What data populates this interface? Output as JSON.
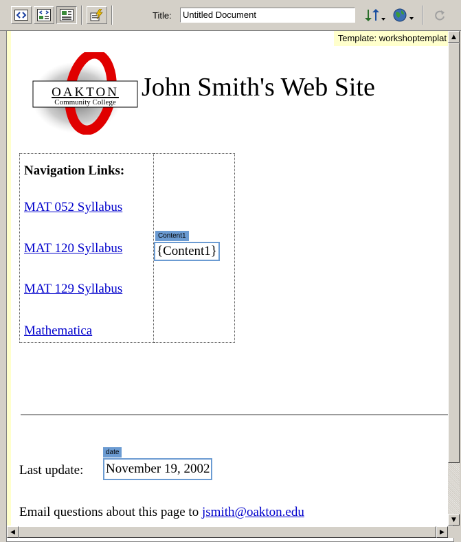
{
  "toolbar": {
    "title_label": "Title:",
    "title_value": "Untitled Document",
    "buttons": [
      {
        "name": "code-view-icon",
        "glyph": "<>"
      },
      {
        "name": "split-view-icon"
      },
      {
        "name": "design-view-icon"
      },
      {
        "name": "live-data-icon"
      },
      {
        "name": "file-management-icon"
      },
      {
        "name": "preview-browser-icon"
      },
      {
        "name": "refresh-icon"
      }
    ]
  },
  "document": {
    "template_tag": "Template: workshoptemplat",
    "logo": {
      "name_text": "OAKTON",
      "subtext": "Community College"
    },
    "site_title": "John Smith's Web Site",
    "navigation": {
      "heading": "Navigation Links:",
      "links": [
        "MAT 052 Syllabus",
        "MAT 120 Syllabus",
        "MAT 129 Syllabus",
        "Mathematica"
      ]
    },
    "content_region": {
      "tag": "Content1",
      "placeholder": "{Content1}"
    },
    "date_region": {
      "tag": "date"
    },
    "last_update_label": "Last update:",
    "last_update_value": "November 19, 2002",
    "email_text": "Email questions about this page to",
    "email_link": "jsmith@oakton.edu"
  },
  "colors": {
    "toolbar_bg": "#d4d0c8",
    "editable_region": "#6b9bd2",
    "link": "#0000cc",
    "template_tag_bg": "#ffffcc"
  }
}
